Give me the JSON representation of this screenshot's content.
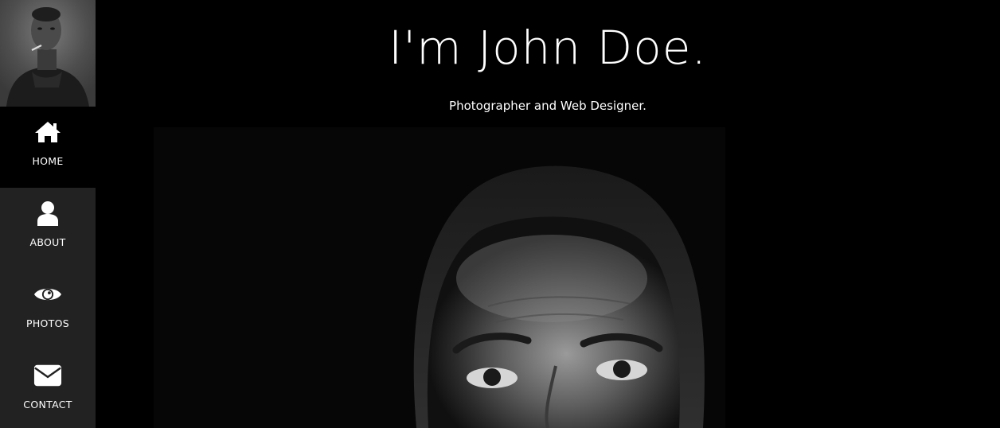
{
  "profile": {
    "avatar_alt": "John Doe portrait"
  },
  "nav": {
    "items": [
      {
        "label": "HOME",
        "icon": "home-icon",
        "active": true
      },
      {
        "label": "ABOUT",
        "icon": "user-icon",
        "active": false
      },
      {
        "label": "PHOTOS",
        "icon": "eye-icon",
        "active": false
      },
      {
        "label": "CONTACT",
        "icon": "envelope-icon",
        "active": false
      }
    ]
  },
  "header": {
    "title": "I'm John Doe.",
    "subtitle": "Photographer and Web Designer."
  },
  "hero": {
    "image_alt": "Black and white portrait of a man"
  },
  "colors": {
    "sidebar_bg": "#222222",
    "active_bg": "#000000",
    "page_bg": "#000000",
    "text": "#ffffff"
  }
}
